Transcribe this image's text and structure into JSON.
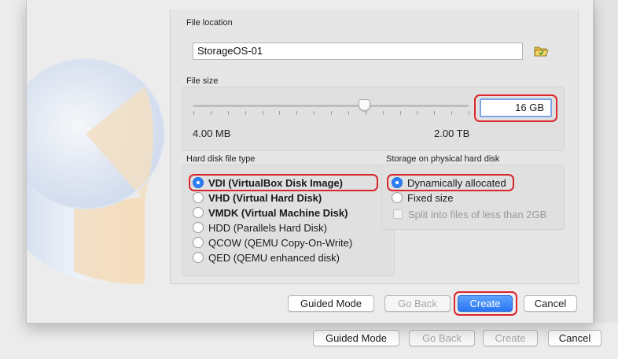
{
  "file_location": {
    "label": "File location",
    "value": "StorageOS-01"
  },
  "file_size": {
    "label": "File size",
    "value": "16 GB",
    "min_label": "4.00 MB",
    "max_label": "2.00 TB",
    "slider_fraction": 0.62
  },
  "disk_type": {
    "label": "Hard disk file type",
    "options": [
      {
        "label": "VDI (VirtualBox Disk Image)",
        "selected": true
      },
      {
        "label": "VHD (Virtual Hard Disk)",
        "selected": false
      },
      {
        "label": "VMDK (Virtual Machine Disk)",
        "selected": false
      },
      {
        "label": "HDD (Parallels Hard Disk)",
        "selected": false
      },
      {
        "label": "QCOW (QEMU Copy-On-Write)",
        "selected": false
      },
      {
        "label": "QED (QEMU enhanced disk)",
        "selected": false
      }
    ]
  },
  "storage": {
    "label": "Storage on physical hard disk",
    "dynamic": "Dynamically allocated",
    "fixed": "Fixed size",
    "split": "Split into files of less than 2GB"
  },
  "dialog_buttons": {
    "guided": "Guided Mode",
    "back": "Go Back",
    "create": "Create",
    "cancel": "Cancel"
  },
  "parent_buttons": {
    "guided": "Guided Mode",
    "back": "Go Back",
    "create": "Create",
    "cancel": "Cancel"
  },
  "icons": {
    "folder": "folder-open-icon"
  },
  "colors": {
    "accent": "#2a77f3",
    "highlight": "#d9262c"
  }
}
